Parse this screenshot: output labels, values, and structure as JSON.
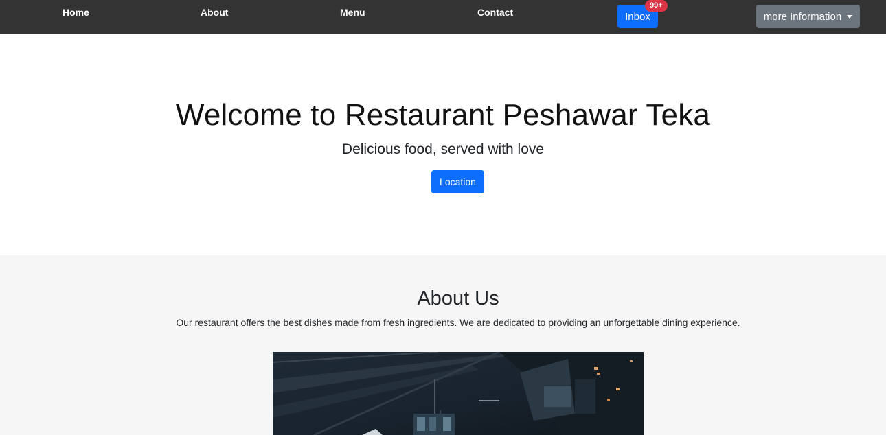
{
  "nav": {
    "items": [
      {
        "label": "Home"
      },
      {
        "label": "About"
      },
      {
        "label": "Menu"
      },
      {
        "label": "Contact"
      }
    ],
    "inbox_label": "Inbox",
    "inbox_badge": "99+",
    "dropdown_label": "more Information"
  },
  "hero": {
    "title": "Welcome to Restaurant Peshawar Teka",
    "subtitle": "Delicious food, served with love",
    "location_button": "Location"
  },
  "about": {
    "title": "About Us",
    "text": "Our restaurant offers the best dishes made from fresh ingredients. We are dedicated to providing an unforgettable dining experience."
  },
  "colors": {
    "navbar_bg": "#333333",
    "primary": "#0d6efd",
    "badge": "#dc3545",
    "secondary": "#6c757d",
    "section_bg": "#f6f6f6"
  }
}
